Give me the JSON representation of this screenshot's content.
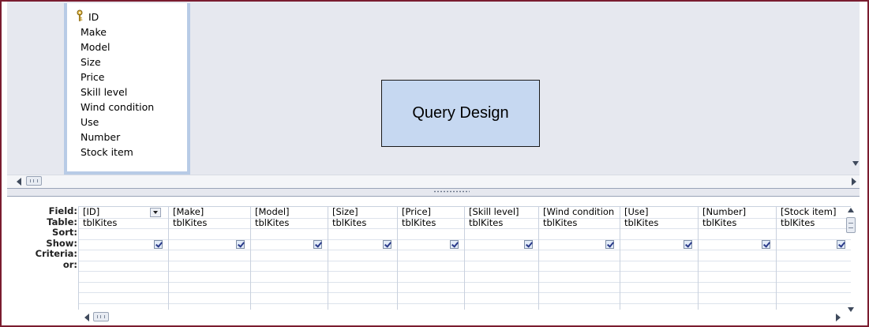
{
  "field_list": {
    "items": [
      "ID",
      "Make",
      "Model",
      "Size",
      "Price",
      "Skill level",
      "Wind condition",
      "Use",
      "Number",
      "Stock item"
    ],
    "key_field": "ID"
  },
  "annotation": {
    "label": "Query Design"
  },
  "grid": {
    "row_labels": [
      "Field:",
      "Table:",
      "Sort:",
      "Show:",
      "Criteria:",
      "or:"
    ],
    "columns": [
      {
        "field": "[ID]",
        "table": "tblKites",
        "show": true
      },
      {
        "field": "[Make]",
        "table": "tblKites",
        "show": true
      },
      {
        "field": "[Model]",
        "table": "tblKites",
        "show": true
      },
      {
        "field": "[Size]",
        "table": "tblKites",
        "show": true
      },
      {
        "field": "[Price]",
        "table": "tblKites",
        "show": true
      },
      {
        "field": "[Skill level]",
        "table": "tblKites",
        "show": true
      },
      {
        "field": "[Wind condition",
        "table": "tblKites",
        "show": true
      },
      {
        "field": "[Use]",
        "table": "tblKites",
        "show": true
      },
      {
        "field": "[Number]",
        "table": "tblKites",
        "show": true
      },
      {
        "field": "[Stock item]",
        "table": "tblKites",
        "show": true
      }
    ]
  },
  "colors": {
    "frame": "#7a1c2f",
    "annotation_fill": "#c6d8f1",
    "design_area": "#e6e8ef",
    "field_list_border": "#b8cbe6"
  },
  "icons": {
    "key": "key-icon",
    "checkbox": "checkbox-icon",
    "dropdown": "dropdown-arrow-icon"
  }
}
